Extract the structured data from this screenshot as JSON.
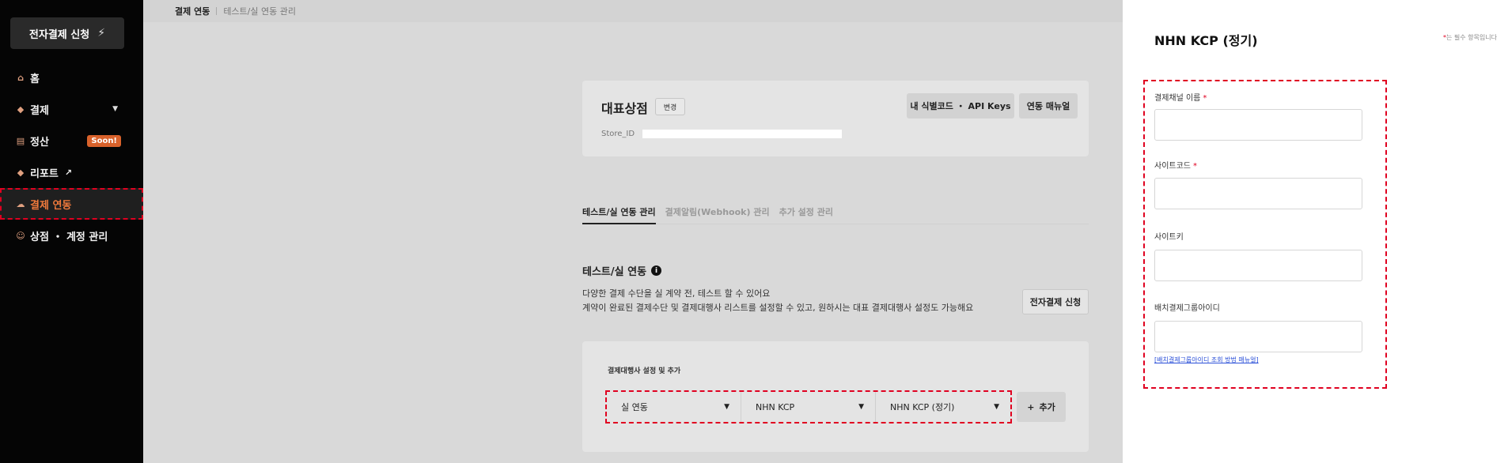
{
  "sidebar": {
    "apply_button": "전자결제 신청",
    "items": [
      {
        "label": "홈"
      },
      {
        "label": "결제"
      },
      {
        "label": "정산",
        "badge": "Soon!"
      },
      {
        "label": "리포트"
      },
      {
        "label": "결제 연동"
      },
      {
        "label": "상점 ・ 계정 관리"
      }
    ]
  },
  "breadcrumb": {
    "current": "결제 연동",
    "sub": "테스트/실 연동 관리"
  },
  "store": {
    "title": "대표상점",
    "change_label": "변경",
    "keys_label": "내 식별코드 ・ API Keys",
    "manual_label": "연동 매뉴얼",
    "store_id_label": "Store_ID"
  },
  "tabs": [
    {
      "label": "테스트/실 연동 관리",
      "active": true
    },
    {
      "label": "결제알림(Webhook) 관리"
    },
    {
      "label": "추가 설정 관리"
    }
  ],
  "integration": {
    "title": "테스트/실 연동",
    "desc_1": "다양한 결제 수단을 실 계약 전, 테스트 할 수 있어요",
    "desc_2": "계약이 완료된 결제수단 및 결제대행사 리스트를 설정할 수 있고, 원하시는 대표 결제대행사 설정도 가능해요",
    "apply_label": "전자결제 신청"
  },
  "pg": {
    "label": "결제대행사 설정 및 추가",
    "selects": [
      "실 연동",
      "NHN KCP",
      "NHN KCP (정기)"
    ],
    "add_label": "추가"
  },
  "panel": {
    "title": "NHN KCP (정기)",
    "required_note": "는 필수 항목입니다",
    "fields": [
      {
        "label": "결제채널 이름",
        "required": true,
        "value": ""
      },
      {
        "label": "사이트코드",
        "required": true,
        "value": ""
      },
      {
        "label": "사이트키",
        "required": false,
        "value": ""
      },
      {
        "label": "배치결제그룹아이디",
        "required": false,
        "value": ""
      }
    ],
    "help_link": "[배치결제그룹아이디 조회 방법 매뉴얼]"
  },
  "colors": {
    "accent": "#f07a3c",
    "badge": "#d9622b",
    "required": "#e00020",
    "link": "#2a4fd8"
  }
}
